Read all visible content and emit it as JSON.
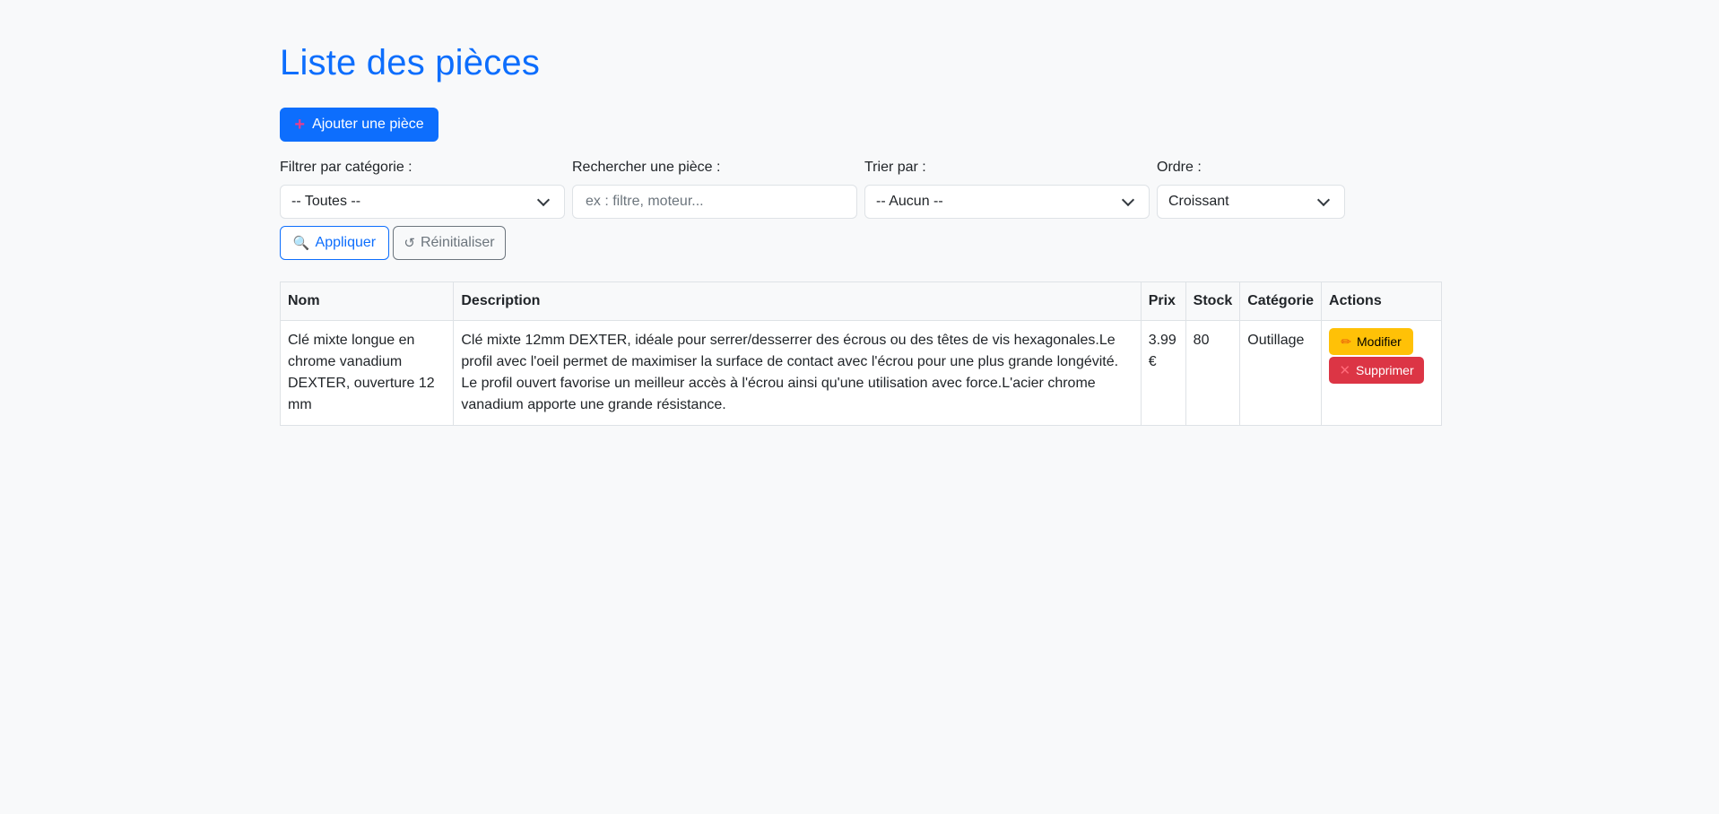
{
  "page": {
    "title": "Liste des pièces",
    "add_button": "Ajouter une pièce"
  },
  "filters": {
    "category": {
      "label": "Filtrer par catégorie :",
      "value": "-- Toutes --"
    },
    "search": {
      "label": "Rechercher une pièce :",
      "placeholder": "ex : filtre, moteur...",
      "value": ""
    },
    "sort": {
      "label": "Trier par :",
      "value": "-- Aucun --"
    },
    "order": {
      "label": "Ordre :",
      "value": "Croissant"
    },
    "apply_button": "Appliquer",
    "reset_button": "Réinitialiser"
  },
  "table": {
    "headers": [
      "Nom",
      "Description",
      "Prix",
      "Stock",
      "Catégorie",
      "Actions"
    ],
    "rows": [
      {
        "name": "Clé mixte longue en chrome vanadium DEXTER, ouverture 12 mm",
        "description": "Clé mixte 12mm DEXTER, idéale pour serrer/desserrer des écrous ou des têtes de vis hexagonales.Le profil avec l'oeil permet de maximiser la surface de contact avec l'écrou pour une plus grande longévité. Le profil ouvert favorise un meilleur accès à l'écrou ainsi qu'une utilisation avec force.L'acier chrome vanadium apporte une grande résistance.",
        "price": "3.99 €",
        "stock": "80",
        "category": "Outillage",
        "edit_label": "Modifier",
        "delete_label": "Supprimer"
      }
    ]
  },
  "colors": {
    "primary": "#0d6efd",
    "warning": "#ffc107",
    "danger": "#dc3545",
    "background": "#f8f9fa"
  },
  "icons": {
    "add": "plus-icon",
    "apply": "magnifier-icon",
    "reset": "refresh-icon",
    "edit": "pencil-icon",
    "delete": "x-icon"
  }
}
